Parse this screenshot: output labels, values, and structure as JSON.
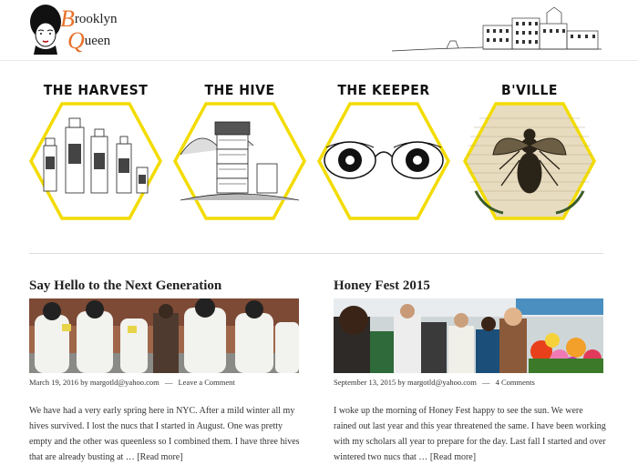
{
  "site": {
    "logo_cap1": "B",
    "logo_rest1": "rooklyn",
    "logo_cap2": "Q",
    "logo_rest2": "ueen"
  },
  "nav": [
    {
      "title": "THE HARVEST",
      "icon": "honey-jars-icon"
    },
    {
      "title": "THE HIVE",
      "icon": "beehive-icon"
    },
    {
      "title": "THE KEEPER",
      "icon": "eyes-glasses-icon"
    },
    {
      "title": "B'VILLE",
      "icon": "bee-icon"
    }
  ],
  "colors": {
    "hex_border": "#f2dc00",
    "accent": "#e8702a"
  },
  "posts": [
    {
      "title": "Say Hello to the Next Generation",
      "date": "March 19, 2016",
      "by": "by",
      "author": "margotld@yahoo.com",
      "sep": "—",
      "comments": "Leave a Comment",
      "excerpt": "We have had a very early spring here in NYC.  After a mild winter all my hives survived.  I lost the nucs that I started in August.  One was pretty empty and the other was queenless so I combined them.  I have three hives that are already busting at … ",
      "more": "[Read more]"
    },
    {
      "title": "Honey Fest 2015",
      "date": "September 13, 2015",
      "by": "by",
      "author": "margotld@yahoo.com",
      "sep": "—",
      "comments": "4 Comments",
      "excerpt": "I woke up the morning of Honey Fest happy to see the sun.  We were rained out last year and this year threatened the same.  I have been working with my scholars all year to prepare for the day.  Last fall I started and over wintered two nucs that … ",
      "more": "[Read more]"
    }
  ]
}
